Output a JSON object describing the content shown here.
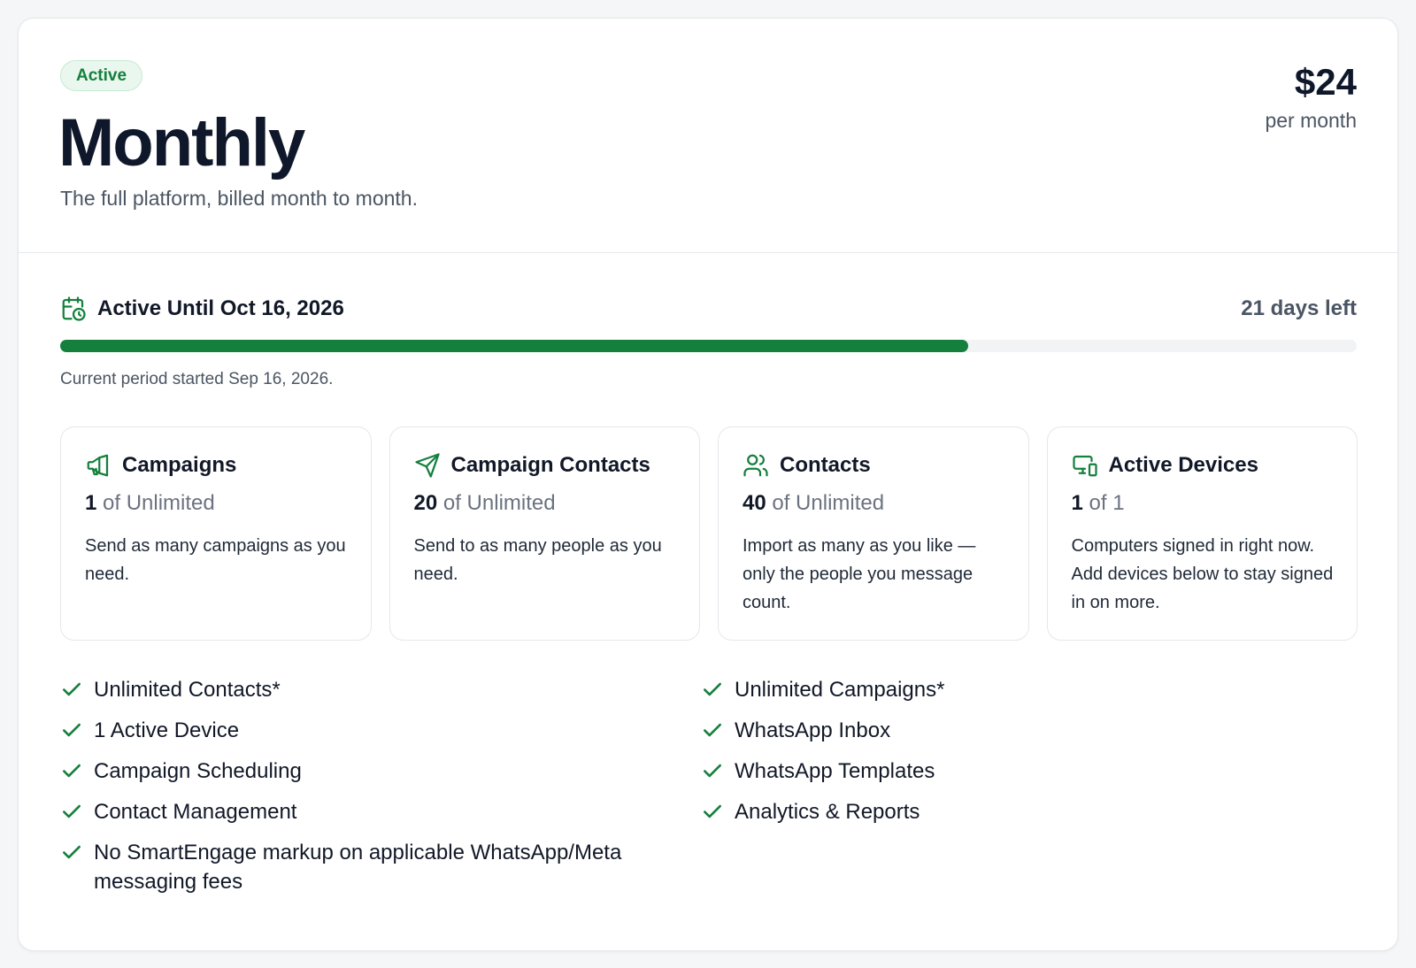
{
  "plan": {
    "status_badge": "Active",
    "name": "Monthly",
    "description": "The full platform, billed month to month.",
    "price": "$24",
    "price_period": "per month"
  },
  "period": {
    "icon": "calendar-clock-icon",
    "label": "Active Until Oct 16, 2026",
    "days_left": "21 days left",
    "progress_fraction": 0.7,
    "note": "Current period started Sep 16, 2026."
  },
  "usage": [
    {
      "icon": "megaphone-icon",
      "title": "Campaigns",
      "used": "1",
      "limit": "of Unlimited",
      "description": "Send as many campaigns as you need."
    },
    {
      "icon": "send-icon",
      "title": "Campaign Contacts",
      "used": "20",
      "limit": "of Unlimited",
      "description": "Send to as many people as you need."
    },
    {
      "icon": "users-icon",
      "title": "Contacts",
      "used": "40",
      "limit": "of Unlimited",
      "description": "Import as many as you like — only the people you message count."
    },
    {
      "icon": "devices-icon",
      "title": "Active Devices",
      "used": "1",
      "limit": "of 1",
      "description": "Computers signed in right now. Add devices below to stay signed in on more."
    }
  ],
  "features": {
    "left": [
      "Unlimited Contacts*",
      "1 Active Device",
      "Campaign Scheduling",
      "Contact Management",
      "No SmartEngage markup on applicable WhatsApp/Meta messaging fees"
    ],
    "right": [
      "Unlimited Campaigns*",
      "WhatsApp Inbox",
      "WhatsApp Templates",
      "Analytics & Reports"
    ]
  },
  "colors": {
    "accent": "#15803d",
    "badge_bg": "#e9f7ee",
    "text_primary": "#111827",
    "text_muted": "#4b5563",
    "border": "#e5e7eb"
  }
}
